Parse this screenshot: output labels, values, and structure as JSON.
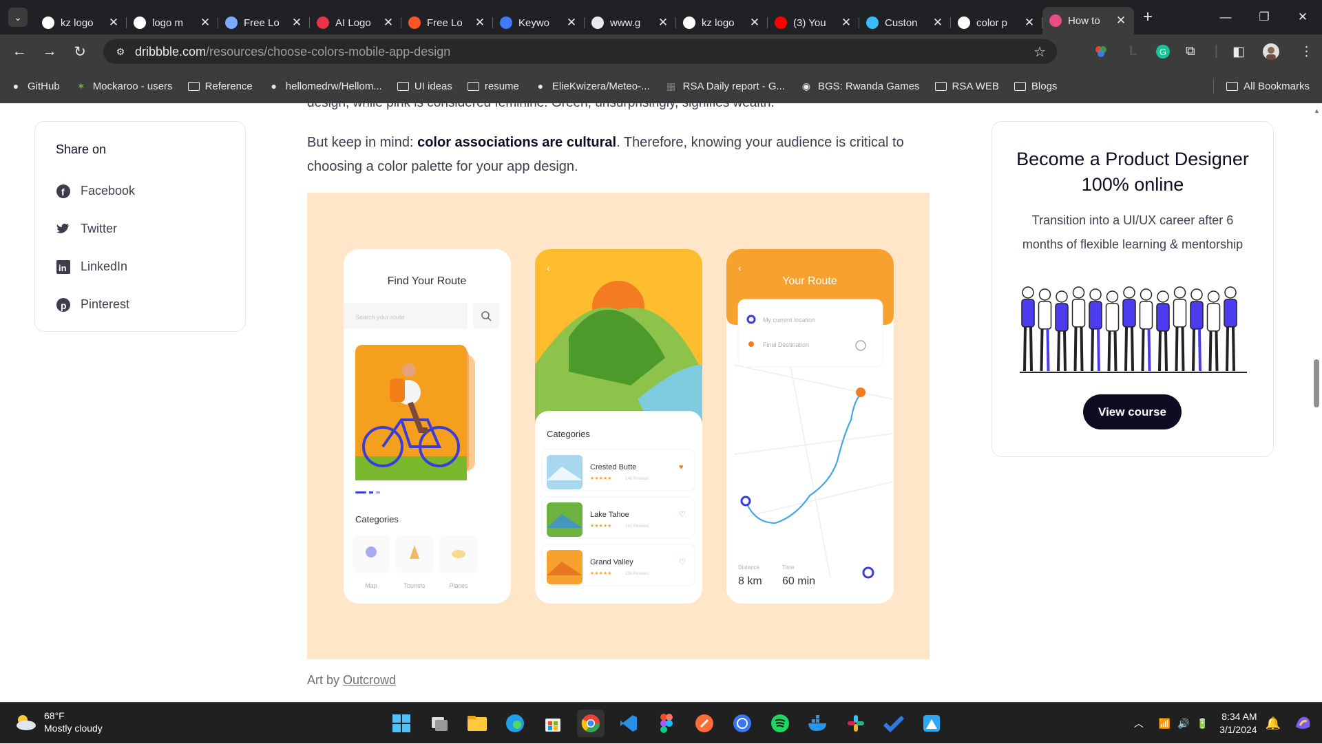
{
  "tabs": [
    {
      "title": "kz logo",
      "icon": "google-icon",
      "color": "#ffffff"
    },
    {
      "title": "logo m",
      "icon": "google-icon",
      "color": "#ffffff"
    },
    {
      "title": "Free Lo",
      "icon": "dh-icon",
      "color": "#7aa9ff"
    },
    {
      "title": "AI Logo",
      "icon": "heart-logo-icon",
      "color": "#e8334a"
    },
    {
      "title": "Free Lo",
      "icon": "orange-logo-icon",
      "color": "#ff5722"
    },
    {
      "title": "Keywo",
      "icon": "keyword-icon",
      "color": "#3d7cff"
    },
    {
      "title": "www.g",
      "icon": "globe-icon",
      "color": "#e8eaed"
    },
    {
      "title": "kz logo",
      "icon": "google-icon",
      "color": "#ffffff"
    },
    {
      "title": "(3) You",
      "icon": "youtube-icon",
      "color": "#ff0000"
    },
    {
      "title": "Custon",
      "icon": "wave-icon",
      "color": "#38bdf8"
    },
    {
      "title": "color p",
      "icon": "google-icon",
      "color": "#ffffff"
    },
    {
      "title": "How to",
      "icon": "dribbble-icon",
      "color": "#ea4c89",
      "active": true
    }
  ],
  "address": {
    "domain": "dribbble.com",
    "path": "/resources/choose-colors-mobile-app-design"
  },
  "bookmarks": [
    {
      "label": "GitHub",
      "icon": "github-icon"
    },
    {
      "label": "Mockaroo - users",
      "icon": "mockaroo-icon"
    },
    {
      "label": "Reference",
      "icon": "folder-icon"
    },
    {
      "label": "hellomedrw/Hellom...",
      "icon": "github-icon"
    },
    {
      "label": "UI ideas",
      "icon": "folder-icon"
    },
    {
      "label": "resume",
      "icon": "folder-icon"
    },
    {
      "label": "ElieKwizera/Meteo-...",
      "icon": "github-icon"
    },
    {
      "label": "RSA Daily report - G...",
      "icon": "sheets-icon"
    },
    {
      "label": "BGS: Rwanda Games",
      "icon": "chrome-icon"
    },
    {
      "label": "RSA WEB",
      "icon": "folder-icon"
    },
    {
      "label": "Blogs",
      "icon": "folder-icon"
    }
  ],
  "all_bookmarks": "All Bookmarks",
  "share": {
    "heading": "Share on",
    "items": [
      {
        "label": "Facebook",
        "icon": "facebook-icon"
      },
      {
        "label": "Twitter",
        "icon": "twitter-icon"
      },
      {
        "label": "LinkedIn",
        "icon": "linkedin-icon"
      },
      {
        "label": "Pinterest",
        "icon": "pinterest-icon"
      }
    ]
  },
  "article": {
    "cut_text": "design, while pink is considered feminine. Green, unsurprisingly, signifies wealth.",
    "para_pre": "But keep in mind: ",
    "para_bold": "color associations are cultural",
    "para_post": ". Therefore, knowing your audience is critical to choosing a color palette for your app design.",
    "caption_pre": "Art by ",
    "caption_link": "Outcrowd"
  },
  "mock": {
    "p1": {
      "title": "Find Your Route",
      "search": "Search your route",
      "categories": "Categories",
      "cats": [
        "Map",
        "Tourists",
        "Places"
      ]
    },
    "p2": {
      "categories": "Categories",
      "items": [
        {
          "name": "Crested Butte",
          "reviews": "146 Reviews"
        },
        {
          "name": "Lake Tahoe",
          "reviews": "142 Reviews"
        },
        {
          "name": "Grand Valley",
          "reviews": "136 Reviews"
        }
      ]
    },
    "p3": {
      "title": "Your Route",
      "from": "My current location",
      "to": "Final Destination",
      "dist_label": "Distance",
      "dist": "8 km",
      "time_label": "Time",
      "time": "60 min"
    }
  },
  "promo": {
    "title": "Become a Product Designer 100% online",
    "desc": "Transition into a UI/UX career after 6 months of flexible learning & mentorship",
    "button": "View course"
  },
  "taskbar": {
    "temp": "68°F",
    "weather": "Mostly cloudy",
    "time": "8:34 AM",
    "date": "3/1/2024"
  },
  "colors": {
    "accent": "#0d0c22",
    "peach": "#ffe6c9",
    "orange": "#f7a22e",
    "blue": "#3a3ed6"
  }
}
